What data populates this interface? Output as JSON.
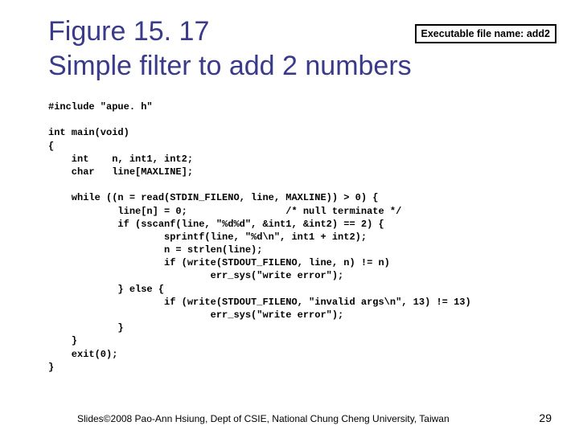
{
  "title_line1": "Figure 15. 17",
  "title_line2": "Simple filter to add 2 numbers",
  "badge": "Executable file name: add2",
  "code": "#include \"apue. h\"\n\nint main(void)\n{\n    int    n, int1, int2;\n    char   line[MAXLINE];\n\n    while ((n = read(STDIN_FILENO, line, MAXLINE)) > 0) {\n            line[n] = 0;                 /* null terminate */\n            if (sscanf(line, \"%d%d\", &int1, &int2) == 2) {\n                    sprintf(line, \"%d\\n\", int1 + int2);\n                    n = strlen(line);\n                    if (write(STDOUT_FILENO, line, n) != n)\n                            err_sys(\"write error\");\n            } else {\n                    if (write(STDOUT_FILENO, \"invalid args\\n\", 13) != 13)\n                            err_sys(\"write error\");\n            }\n    }\n    exit(0);\n}",
  "footer": "Slides©2008 Pao-Ann Hsiung, Dept of CSIE, National Chung Cheng University, Taiwan",
  "page": "29"
}
